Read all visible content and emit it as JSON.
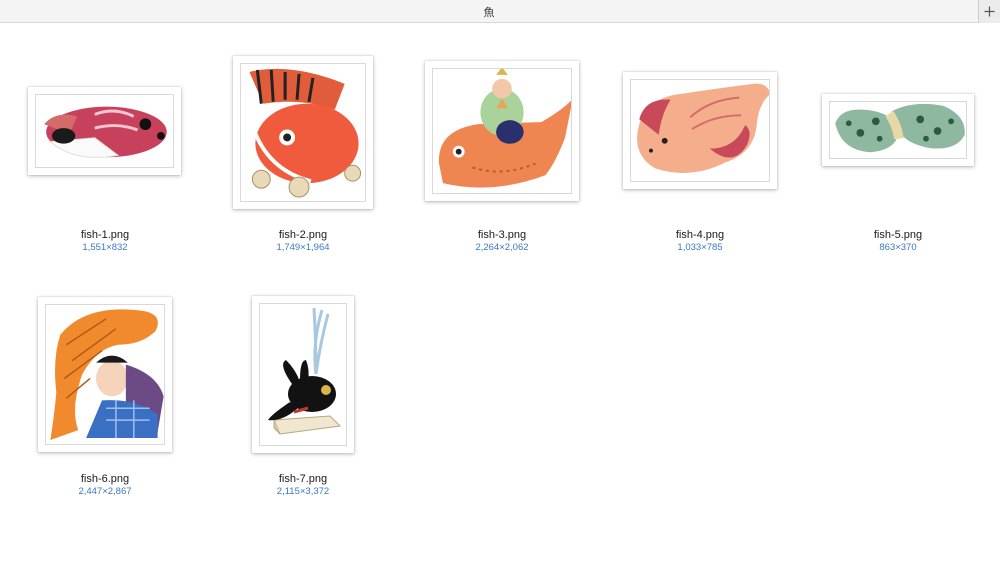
{
  "window": {
    "title": "魚",
    "new_tab_icon": "plus-icon"
  },
  "files": [
    {
      "name": "fish-1.png",
      "dimensions": "1,551×832"
    },
    {
      "name": "fish-2.png",
      "dimensions": "1,749×1,964"
    },
    {
      "name": "fish-3.png",
      "dimensions": "2,264×2,062"
    },
    {
      "name": "fish-4.png",
      "dimensions": "1,033×785"
    },
    {
      "name": "fish-5.png",
      "dimensions": "863×370"
    },
    {
      "name": "fish-6.png",
      "dimensions": "2,447×2,867"
    },
    {
      "name": "fish-7.png",
      "dimensions": "2,115×3,372"
    }
  ],
  "colors": {
    "label_text": "#1a1a1a",
    "dimension_text": "#3a78c3"
  }
}
